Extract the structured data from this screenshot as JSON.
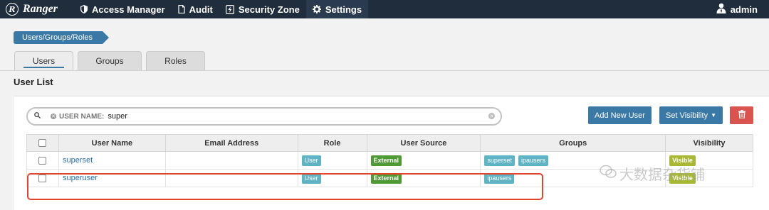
{
  "nav": {
    "brand": "Ranger",
    "brand_logo_letter": "R",
    "items": [
      {
        "label": "Access Manager",
        "icon": "shield-icon"
      },
      {
        "label": "Audit",
        "icon": "file-icon"
      },
      {
        "label": "Security Zone",
        "icon": "bolt-icon"
      },
      {
        "label": "Settings",
        "icon": "gear-icon"
      }
    ],
    "user": "admin"
  },
  "breadcrumb": "Users/Groups/Roles",
  "tabs": [
    "Users",
    "Groups",
    "Roles"
  ],
  "page_title": "User List",
  "search": {
    "filter_key": "USER NAME:",
    "filter_value": "super"
  },
  "buttons": {
    "add_user": "Add New User",
    "set_visibility": "Set Visibility"
  },
  "table": {
    "headers": [
      "User Name",
      "Email Address",
      "Role",
      "User Source",
      "Groups",
      "Visibility"
    ],
    "rows": [
      {
        "name": "superset",
        "email": "",
        "role": "User",
        "source": "External",
        "groups": [
          "superset",
          "ipausers"
        ],
        "visibility": "Visible"
      },
      {
        "name": "superuser",
        "email": "",
        "role": "User",
        "source": "External",
        "groups": [
          "ipausers"
        ],
        "visibility": "Visible"
      }
    ]
  },
  "watermark": "大数据杂货铺",
  "colors": {
    "navbar": "#1f2d3d",
    "primary": "#3a78a6",
    "danger": "#d9534f",
    "external_label": "#4f9a34",
    "visible_label": "#a8b833",
    "role_label": "#5fb3c3",
    "highlight": "#e2452b"
  }
}
